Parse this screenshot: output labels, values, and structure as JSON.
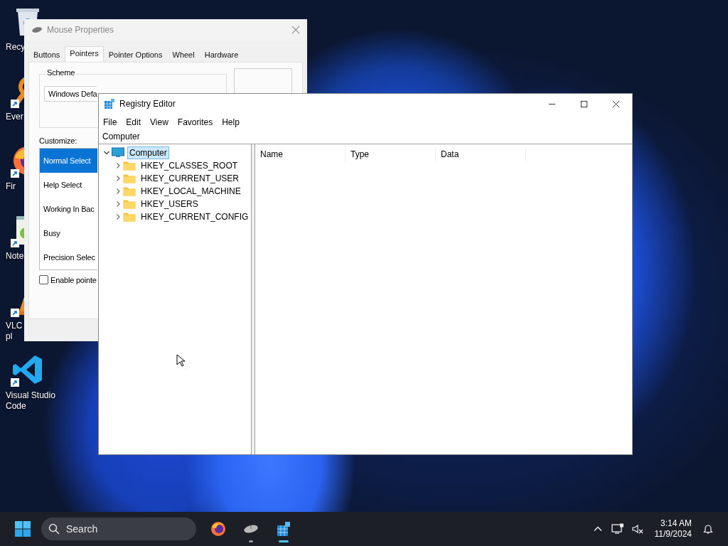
{
  "desktop_icons": [
    {
      "kind": "recycle-bin",
      "shortcut": false,
      "label_lines": [
        "Recy"
      ]
    },
    {
      "kind": "magnifier",
      "shortcut": true,
      "label_lines": [
        "Ever"
      ]
    },
    {
      "kind": "firefox",
      "shortcut": true,
      "label_lines": [
        "Fir"
      ]
    },
    {
      "kind": "notepad",
      "shortcut": true,
      "label_lines": [
        "Note"
      ]
    },
    {
      "kind": "vlc",
      "shortcut": true,
      "label_lines": [
        "VLC",
        "pl"
      ]
    },
    {
      "kind": "vscode",
      "shortcut": true,
      "label_lines": [
        "Visual Studio",
        "Code"
      ]
    }
  ],
  "mouse_properties": {
    "title": "Mouse Properties",
    "tabs": [
      {
        "label": "Buttons",
        "selected": false
      },
      {
        "label": "Pointers",
        "selected": true
      },
      {
        "label": "Pointer Options",
        "selected": false
      },
      {
        "label": "Wheel",
        "selected": false
      },
      {
        "label": "Hardware",
        "selected": false
      }
    ],
    "scheme": {
      "label": "Scheme",
      "value": "Windows Defa"
    },
    "customize_label": "Customize:",
    "pointers": [
      {
        "label": "Normal Select",
        "selected": true
      },
      {
        "label": "Help Select",
        "selected": false
      },
      {
        "label": "Working In Bac",
        "selected": false
      },
      {
        "label": "Busy",
        "selected": false
      },
      {
        "label": "Precision Selec",
        "selected": false
      }
    ],
    "checkbox": {
      "label": "Enable pointe",
      "checked": false
    }
  },
  "registry_editor": {
    "title": "Registry Editor",
    "menu": [
      "File",
      "Edit",
      "View",
      "Favorites",
      "Help"
    ],
    "address": "Computer",
    "tree": [
      {
        "kind": "computer",
        "label": "Computer",
        "expanded": true,
        "selected": true,
        "children": [
          {
            "kind": "folder",
            "label": "HKEY_CLASSES_ROOT",
            "expanded": false,
            "selected": false
          },
          {
            "kind": "folder",
            "label": "HKEY_CURRENT_USER",
            "expanded": false,
            "selected": false
          },
          {
            "kind": "folder",
            "label": "HKEY_LOCAL_MACHINE",
            "expanded": false,
            "selected": false
          },
          {
            "kind": "folder",
            "label": "HKEY_USERS",
            "expanded": false,
            "selected": false
          },
          {
            "kind": "folder",
            "label": "HKEY_CURRENT_CONFIG",
            "expanded": false,
            "selected": false
          }
        ]
      }
    ],
    "columns": [
      "Name",
      "Type",
      "Data"
    ]
  },
  "taskbar": {
    "search": {
      "placeholder": "Search"
    },
    "apps": [
      {
        "kind": "firefox",
        "running": false,
        "active": false
      },
      {
        "kind": "mouse",
        "running": true,
        "active": false
      },
      {
        "kind": "registry",
        "running": true,
        "active": true
      }
    ],
    "time": "3:14 AM",
    "date": "11/9/2024"
  }
}
